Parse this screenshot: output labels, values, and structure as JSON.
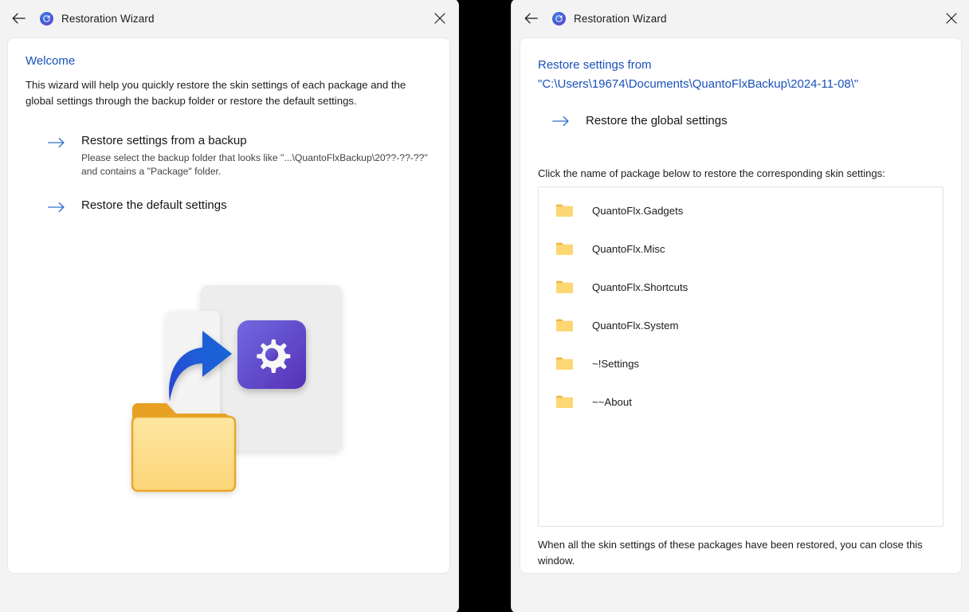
{
  "theme": {
    "accent_link": "#1a51b8",
    "arrow_blue": "#2f6fd0",
    "window_bg": "#f3f3f3",
    "card_bg": "#ffffff",
    "folder_yellow": "#fcd670",
    "gear_purple": "#5b42c4",
    "backdrop": "#000000"
  },
  "left_window": {
    "titlebar": {
      "title": "Restoration Wizard",
      "back_icon": "back-arrow-icon",
      "app_icon": "restore-app-icon",
      "close_icon": "close-icon"
    },
    "heading": "Welcome",
    "intro": "This wizard will help you quickly restore the skin settings of each package and the global settings through the backup folder or restore the default settings.",
    "actions": [
      {
        "title": "Restore settings from a backup",
        "desc": "Please select the backup folder that looks like \"...\\QuantoFlxBackup\\20??-??-??\" and contains a \"Package\" folder."
      },
      {
        "title": "Restore the default settings",
        "desc": ""
      }
    ],
    "illustration": {
      "name": "restore-settings-illustration",
      "parts": [
        "back-card",
        "front-card",
        "share-arrow",
        "gear-tile",
        "folder"
      ]
    }
  },
  "right_window": {
    "titlebar": {
      "title": "Restoration Wizard",
      "back_icon": "back-arrow-icon",
      "app_icon": "restore-app-icon",
      "close_icon": "close-icon"
    },
    "heading": "Restore settings from \"C:\\Users\\19674\\Documents\\QuantoFlxBackup\\2024-11-08\\\"",
    "global_action": "Restore the global settings",
    "list_hint": "Click the name of package below to restore the corresponding skin settings:",
    "packages": [
      "QuantoFlx.Gadgets",
      "QuantoFlx.Misc",
      "QuantoFlx.Shortcuts",
      "QuantoFlx.System",
      "~!Settings",
      "~~About"
    ],
    "footnote": "When all the skin settings of these packages have been restored, you can close this window."
  }
}
